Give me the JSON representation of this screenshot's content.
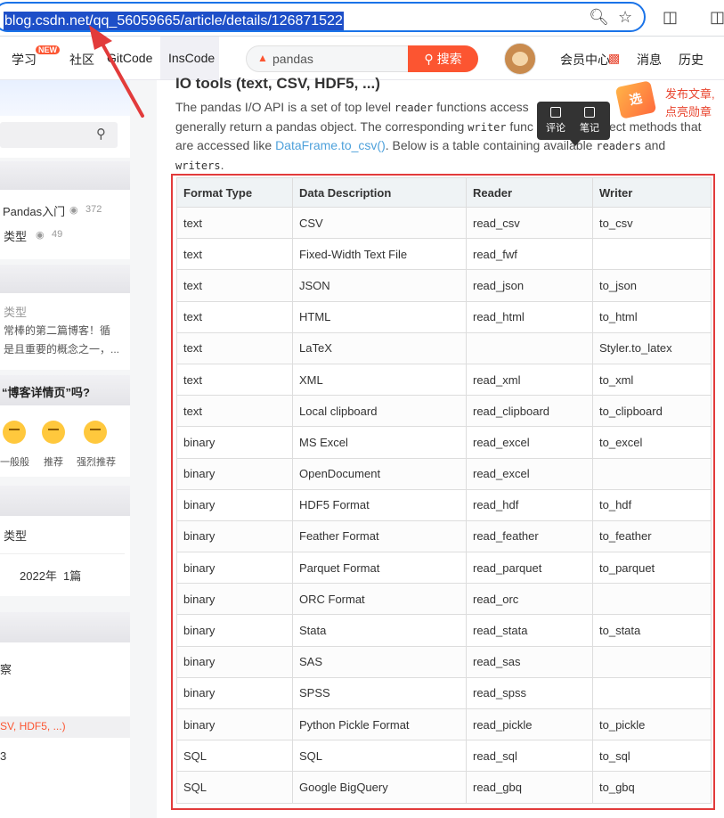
{
  "browser": {
    "url": "blog.csdn.net/qq_56059665/article/details/126871522"
  },
  "nav": {
    "study": "学习",
    "new_badge": "NEW",
    "community": "社区",
    "gitcode": "GitCode",
    "inscode": "InsCode",
    "search_value": "pandas",
    "search_button": "搜索",
    "vip": "会员中心",
    "messages": "消息",
    "history": "历史"
  },
  "sidebar": {
    "hot1_title": "Pandas入门",
    "hot1_views": "372",
    "hot2_title": "类型",
    "hot2_views": "49",
    "new_tag": "类型",
    "new_desc1": "常棒的第二篇博客！循",
    "new_desc2": "是且重要的概念之一，...",
    "survey_title": "“博客详情页”吗?",
    "rate_ok": "一般般",
    "rate_good": "推荐",
    "rate_great": "强烈推荐",
    "cat_item": "类型",
    "archive_year": "2022年",
    "archive_count": "1篇",
    "toc_item1": "察",
    "toc_active": "SV, HDF5, ...)",
    "toc_item3": "3"
  },
  "article": {
    "heading": "IO tools (text, CSV, HDF5, ...)",
    "p1_a": "The pandas I/O API is a set of top level ",
    "p1_code1": "reader",
    "p1_b": " functions access",
    "p2_a": "generally return a pandas object. The corresponding ",
    "p2_code": "writer",
    "p2_b": " func",
    "p2_c": "ect methods that",
    "p3_a": "are accessed like ",
    "p3_link": "DataFrame.to_csv()",
    "p3_b": ". Below is a table containing available ",
    "p3_code": "readers",
    "p3_c": " and",
    "p4_code": "writers",
    "p4_b": "."
  },
  "table": {
    "headers": [
      "Format Type",
      "Data Description",
      "Reader",
      "Writer"
    ],
    "rows": [
      [
        "text",
        "CSV",
        "read_csv",
        "to_csv"
      ],
      [
        "text",
        "Fixed-Width Text File",
        "read_fwf",
        ""
      ],
      [
        "text",
        "JSON",
        "read_json",
        "to_json"
      ],
      [
        "text",
        "HTML",
        "read_html",
        "to_html"
      ],
      [
        "text",
        "LaTeX",
        "",
        "Styler.to_latex"
      ],
      [
        "text",
        "XML",
        "read_xml",
        "to_xml"
      ],
      [
        "text",
        "Local clipboard",
        "read_clipboard",
        "to_clipboard"
      ],
      [
        "binary",
        "MS Excel",
        "read_excel",
        "to_excel"
      ],
      [
        "binary",
        "OpenDocument",
        "read_excel",
        ""
      ],
      [
        "binary",
        "HDF5 Format",
        "read_hdf",
        "to_hdf"
      ],
      [
        "binary",
        "Feather Format",
        "read_feather",
        "to_feather"
      ],
      [
        "binary",
        "Parquet Format",
        "read_parquet",
        "to_parquet"
      ],
      [
        "binary",
        "ORC Format",
        "read_orc",
        ""
      ],
      [
        "binary",
        "Stata",
        "read_stata",
        "to_stata"
      ],
      [
        "binary",
        "SAS",
        "read_sas",
        ""
      ],
      [
        "binary",
        "SPSS",
        "read_spss",
        ""
      ],
      [
        "binary",
        "Python Pickle Format",
        "read_pickle",
        "to_pickle"
      ],
      [
        "SQL",
        "SQL",
        "read_sql",
        "to_sql"
      ],
      [
        "SQL",
        "Google BigQuery",
        "read_gbq",
        "to_gbq"
      ]
    ],
    "plain_descriptions": [
      "Fixed-Width Text File",
      "Local clipboard"
    ]
  },
  "tooltip": {
    "comment": "评论",
    "note": "笔记"
  },
  "badge": {
    "icon_text": "选",
    "line1": "发布文章,",
    "line2": "点亮勋章"
  },
  "colors": {
    "csdn_red": "#fc5531",
    "link": "#4ea1db",
    "highlight_frame": "#e23b3b",
    "url_selection": "#1e4fc8"
  }
}
